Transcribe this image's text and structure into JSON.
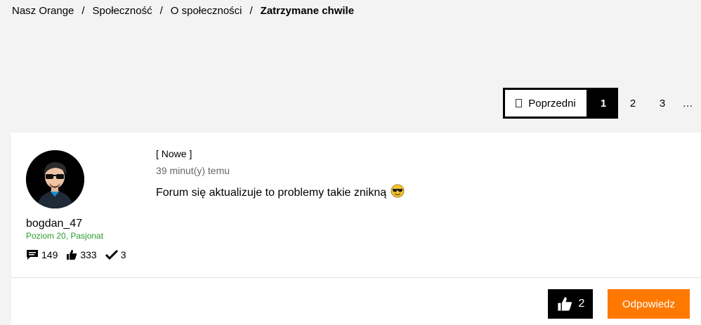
{
  "breadcrumb": {
    "items": [
      "Nasz Orange",
      "Społeczność",
      "O społeczności"
    ],
    "separator": "/",
    "current": "Zatrzymane chwile"
  },
  "pagination": {
    "prev_label": "Poprzedni",
    "pages": [
      "1",
      "2",
      "3"
    ],
    "current_page": "1",
    "ellipsis": "…"
  },
  "post": {
    "badge": "[ Nowe ]",
    "timestamp": "39 minut(y) temu",
    "message": "Forum się aktualizuje to problemy takie znikną",
    "message_emoji": "smiling-face-with-sunglasses-icon",
    "author": {
      "username": "bogdan_47",
      "rank": "Poziom 20, Pasjonat",
      "stats": {
        "posts": "149",
        "likes": "333",
        "solutions": "3"
      }
    },
    "actions": {
      "like_count": "2",
      "reply_label": "Odpowiedz"
    }
  },
  "colors": {
    "accent": "#ff7900",
    "rank_green": "#2e9c2e",
    "page_bg": "#f3f3f3"
  }
}
